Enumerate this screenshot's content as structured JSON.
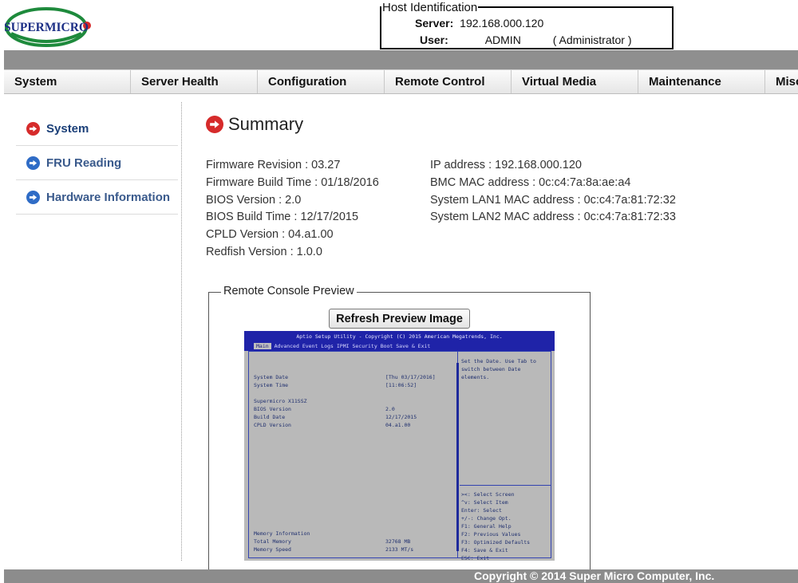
{
  "brand": {
    "logo_text": "SUPERMICRO"
  },
  "host": {
    "legend": "Host Identification",
    "server_label": "Server:",
    "server_value": "192.168.000.120",
    "user_label": "User:",
    "user_value": "ADMIN",
    "user_role": "( Administrator )"
  },
  "nav": {
    "items": [
      "System",
      "Server Health",
      "Configuration",
      "Remote Control",
      "Virtual Media",
      "Maintenance",
      "Misc"
    ]
  },
  "sidebar": {
    "items": [
      {
        "label": "System",
        "icon": "arrow-right-circle-red-icon"
      },
      {
        "label": "FRU Reading",
        "icon": "arrow-right-circle-blue-icon"
      },
      {
        "label": "Hardware Information",
        "icon": "arrow-right-circle-blue-icon"
      }
    ]
  },
  "summary": {
    "title": "Summary",
    "left": [
      "Firmware Revision :  03.27",
      "Firmware Build Time :  01/18/2016",
      "BIOS Version : 2.0",
      "BIOS Build Time : 12/17/2015",
      "CPLD Version : 04.a1.00",
      "Redfish Version : 1.0.0"
    ],
    "right": [
      "IP address :  192.168.000.120",
      "BMC MAC address :  0c:c4:7a:8a:ae:a4",
      "System LAN1 MAC address : 0c:c4:7a:81:72:32",
      "System LAN2 MAC address : 0c:c4:7a:81:72:33"
    ]
  },
  "preview": {
    "legend": "Remote Console Preview",
    "refresh_label": "Refresh Preview Image",
    "bios": {
      "top_line": "Aptio Setup Utility - Copyright (C) 2015 American Megatrends, Inc.",
      "tabs": [
        "Main",
        "Advanced",
        "Event Logs",
        "IPMI",
        "Security",
        "Boot",
        "Save & Exit"
      ],
      "left_lines": [
        {
          "k": "System Date",
          "v": "[Thu 03/17/2016]"
        },
        {
          "k": "System Time",
          "v": "[11:06:52]"
        },
        {
          "k": "",
          "v": ""
        },
        {
          "k": "Supermicro X11SSZ",
          "v": ""
        },
        {
          "k": "BIOS Version",
          "v": "2.0"
        },
        {
          "k": "Build Date",
          "v": "12/17/2015"
        },
        {
          "k": "CPLD Version",
          "v": "04.a1.00"
        }
      ],
      "memory_lines": [
        {
          "k": "Memory Information",
          "v": ""
        },
        {
          "k": "Total Memory",
          "v": "32768 MB"
        },
        {
          "k": "Memory Speed",
          "v": "2133 MT/s"
        }
      ],
      "help_lines": [
        "Set the Date. Use Tab to",
        "switch between Date",
        "elements."
      ],
      "key_lines": [
        "><: Select Screen",
        "^v: Select Item",
        "Enter: Select",
        "+/-: Change Opt.",
        "F1: General Help",
        "F2: Previous Values",
        "F3: Optimized Defaults",
        "F4: Save & Exit",
        "ESC: Exit"
      ]
    }
  },
  "footer": {
    "copyright": "Copyright © 2014 Super Micro Computer, Inc."
  },
  "colors": {
    "nav_bg": "#eeeeee",
    "gray_bar": "#8f8f8f",
    "active_icon": "#d62b2b",
    "inactive_icon": "#2f6cc6",
    "link": "#3a5a8c"
  }
}
